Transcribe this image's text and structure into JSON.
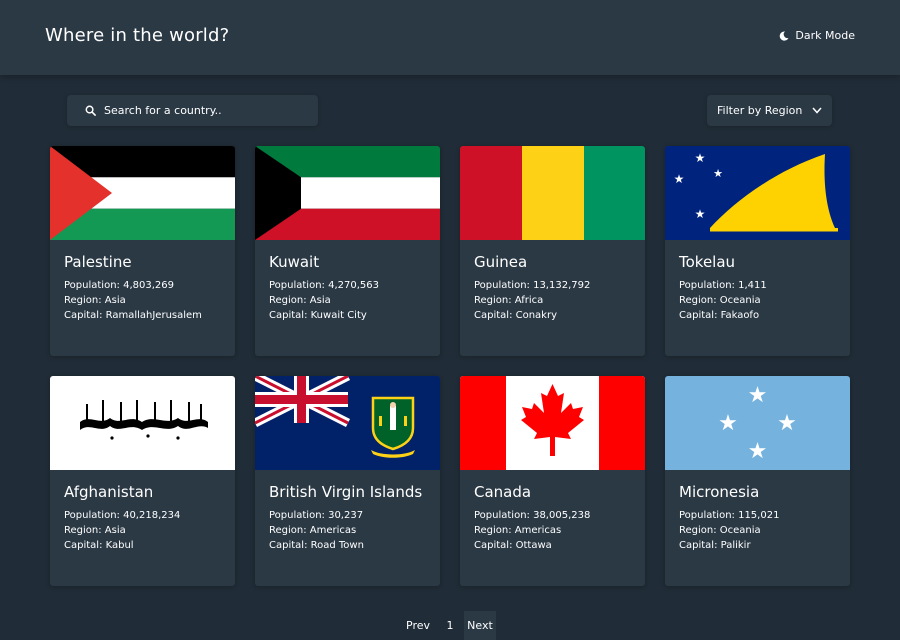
{
  "header": {
    "title": "Where in the world?",
    "mode_label": "Dark Mode",
    "mode_icon": "moon-icon"
  },
  "search": {
    "placeholder": "Search for a country..",
    "icon": "search-icon"
  },
  "filter": {
    "label": "Filter by Region",
    "icon": "chevron-down-icon"
  },
  "countries": [
    {
      "name": "Palestine",
      "population": "Population: 4,803,269",
      "region": "Region: Asia",
      "capital": "Capital: RamallahJerusalem",
      "flag_icon": "palestine-flag-icon"
    },
    {
      "name": "Kuwait",
      "population": "Population: 4,270,563",
      "region": "Region: Asia",
      "capital": "Capital: Kuwait City",
      "flag_icon": "kuwait-flag-icon"
    },
    {
      "name": "Guinea",
      "population": "Population: 13,132,792",
      "region": "Region: Africa",
      "capital": "Capital: Conakry",
      "flag_icon": "guinea-flag-icon"
    },
    {
      "name": "Tokelau",
      "population": "Population: 1,411",
      "region": "Region: Oceania",
      "capital": "Capital: Fakaofo",
      "flag_icon": "tokelau-flag-icon"
    },
    {
      "name": "Afghanistan",
      "population": "Population: 40,218,234",
      "region": "Region: Asia",
      "capital": "Capital: Kabul",
      "flag_icon": "afghanistan-flag-icon"
    },
    {
      "name": "British Virgin Islands",
      "population": "Population: 30,237",
      "region": "Region: Americas",
      "capital": "Capital: Road Town",
      "flag_icon": "british-virgin-islands-flag-icon"
    },
    {
      "name": "Canada",
      "population": "Population: 38,005,238",
      "region": "Region: Americas",
      "capital": "Capital: Ottawa",
      "flag_icon": "canada-flag-icon"
    },
    {
      "name": "Micronesia",
      "population": "Population: 115,021",
      "region": "Region: Oceania",
      "capital": "Capital: Palikir",
      "flag_icon": "micronesia-flag-icon"
    }
  ],
  "pagination": {
    "prev": "Prev",
    "page": "1",
    "next": "Next"
  },
  "colors": {
    "background": "#202c37",
    "element": "#2b3945",
    "text": "#ffffff"
  }
}
